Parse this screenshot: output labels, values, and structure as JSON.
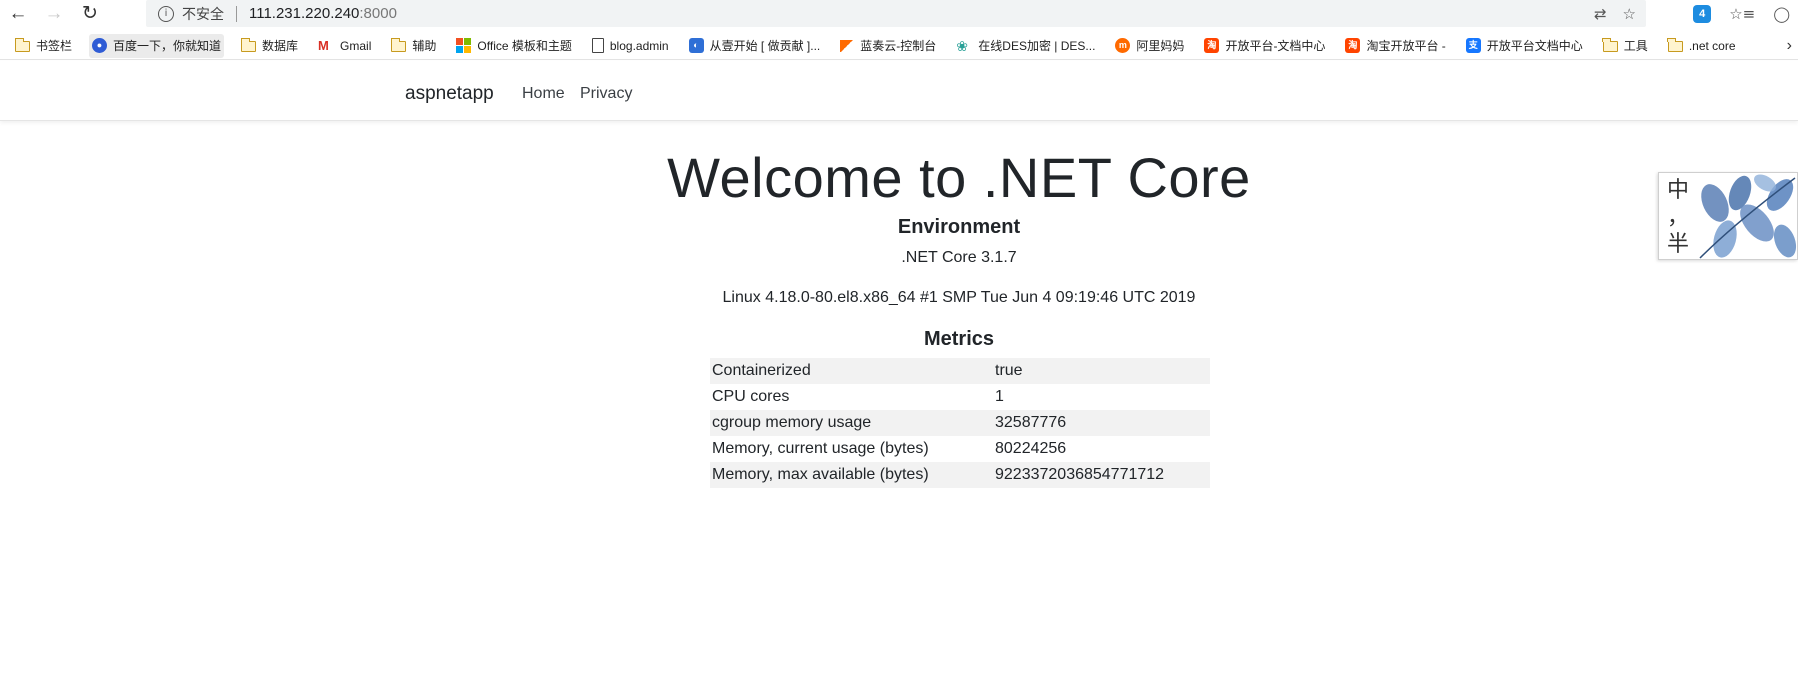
{
  "browser": {
    "insecure_label": "不安全",
    "url_host": "111.231.220.240",
    "url_port": ":8000",
    "bookmarks": [
      {
        "label": "书签栏",
        "icon": "folder-icon"
      },
      {
        "label": "百度一下，你就知道",
        "icon": "baidu-icon"
      },
      {
        "label": "数据库",
        "icon": "folder-icon"
      },
      {
        "label": "Gmail",
        "icon": "gmail-icon"
      },
      {
        "label": "辅助",
        "icon": "folder-icon"
      },
      {
        "label": "Office 模板和主题",
        "icon": "office-icon"
      },
      {
        "label": "blog.admin",
        "icon": "page-icon"
      },
      {
        "label": "从壹开始 [ 做贡献 ]...",
        "icon": "globe-icon"
      },
      {
        "label": "蓝奏云-控制台",
        "icon": "lanzou-icon"
      },
      {
        "label": "在线DES加密 | DES...",
        "icon": "gear-icon"
      },
      {
        "label": "阿里妈妈",
        "icon": "alimama-icon"
      },
      {
        "label": "开放平台-文档中心",
        "icon": "taobao-icon"
      },
      {
        "label": "淘宝开放平台 -",
        "icon": "taobao-icon"
      },
      {
        "label": "开放平台文档中心",
        "icon": "alipay-icon"
      },
      {
        "label": "工具",
        "icon": "folder-icon"
      },
      {
        "label": ".net core",
        "icon": "folder-icon"
      }
    ]
  },
  "app": {
    "brand": "aspnetapp",
    "nav": {
      "home": "Home",
      "privacy": "Privacy"
    }
  },
  "main": {
    "title": "Welcome to .NET Core",
    "environment_heading": "Environment",
    "runtime": ".NET Core 3.1.7",
    "os": "Linux 4.18.0-80.el8.x86_64 #1 SMP Tue Jun 4 09:19:46 UTC 2019",
    "metrics_heading": "Metrics",
    "metrics": [
      {
        "key": "Containerized",
        "value": "true"
      },
      {
        "key": "CPU cores",
        "value": "1"
      },
      {
        "key": "cgroup memory usage",
        "value": "32587776"
      },
      {
        "key": "Memory, current usage (bytes)",
        "value": "80224256"
      },
      {
        "key": "Memory, max available (bytes)",
        "value": "9223372036854771712"
      }
    ]
  },
  "side_widget": {
    "chars": [
      "中",
      "，",
      "半"
    ]
  },
  "colors": {
    "accent_blue": "#1d8ce0",
    "folder": "#c79a1f",
    "row_stripe": "#f2f2f2"
  }
}
